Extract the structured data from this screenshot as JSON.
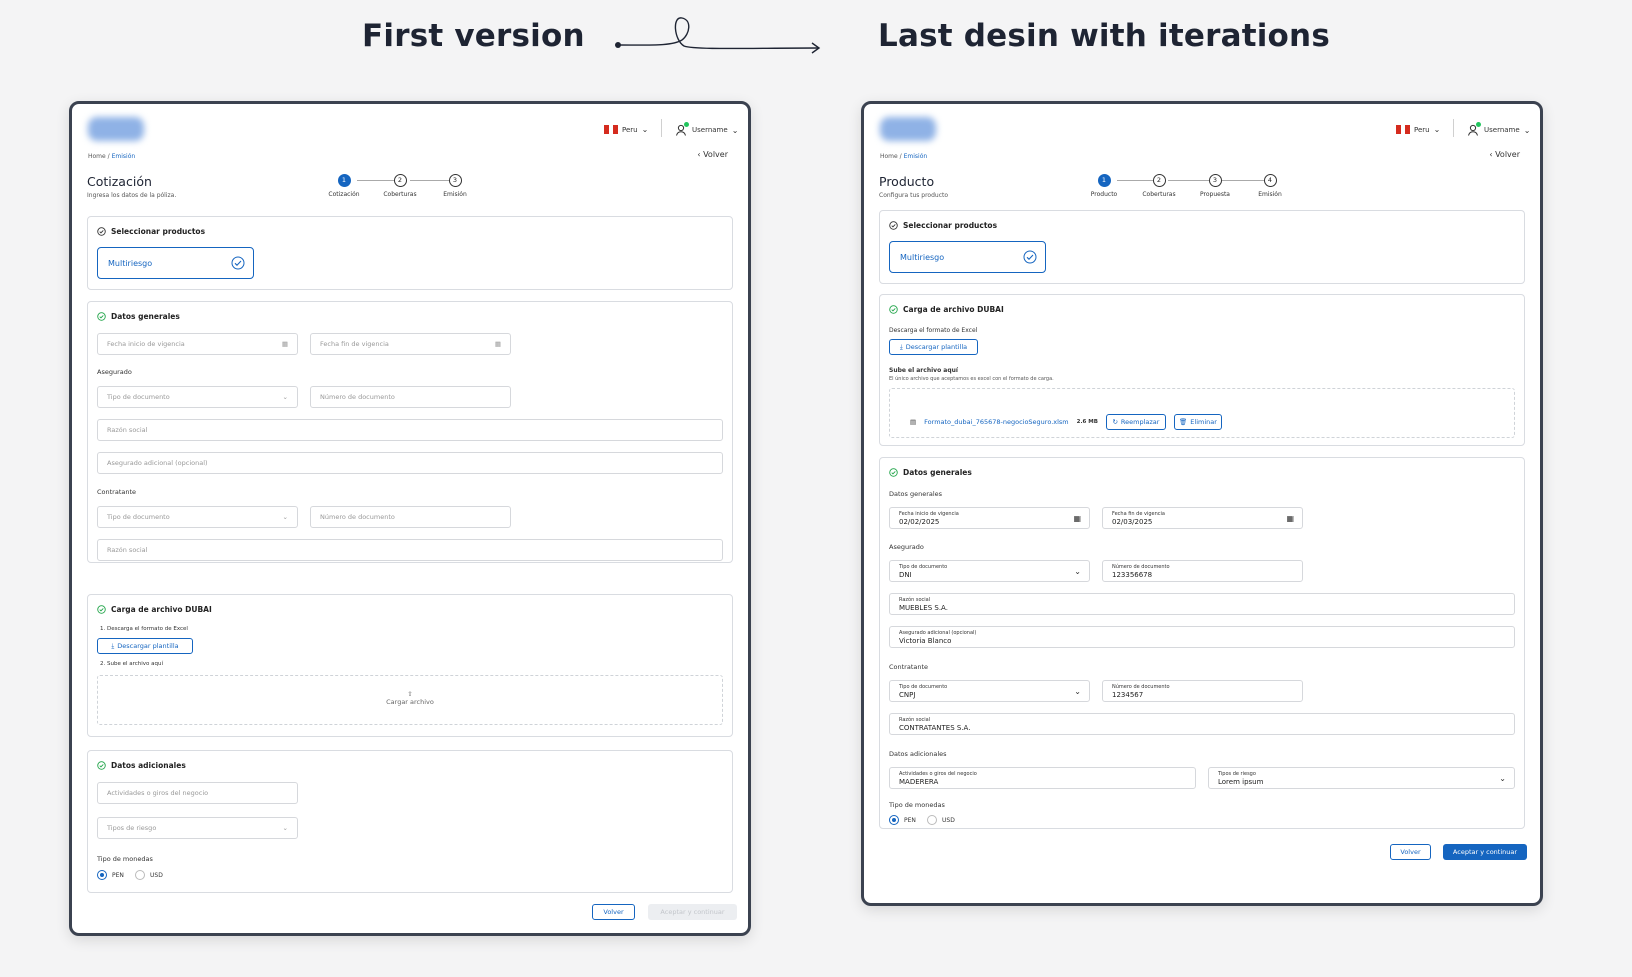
{
  "headings": {
    "left": "First version",
    "right": "Last desin with iterations"
  },
  "v1": {
    "country": "Peru",
    "username": "Username",
    "breadcrumb": {
      "home": "Home",
      "sep": "/",
      "current": "Emisión"
    },
    "back": "Volver",
    "title": "Cotización",
    "subtitle": "Ingresa los datos de la póliza.",
    "steps": [
      {
        "n": "1",
        "label": "Cotización"
      },
      {
        "n": "2",
        "label": "Coberturas"
      },
      {
        "n": "3",
        "label": "Emisión"
      }
    ],
    "select_products": {
      "title": "Seleccionar productos",
      "product": "Multiriesgo"
    },
    "datos_generales": {
      "title": "Datos generales",
      "fecha_inicio": "Fecha inicio de vigencia",
      "fecha_fin": "Fecha fin de vigencia",
      "asegurado": "Asegurado",
      "tipo_doc": "Tipo de documento",
      "num_doc": "Número de documento",
      "razon_social": "Razón social",
      "asegurado_adicional": "Asegurado adicional (opcional)",
      "contratante": "Contratante",
      "tipo_doc2": "Tipo de documento",
      "num_doc2": "Número de documento",
      "razon_social2": "Razón social"
    },
    "carga": {
      "title": "Carga de archivo DUBAI",
      "step1": "1. Descarga el formato de Excel",
      "download": "Descargar plantilla",
      "step2": "2. Sube el archivo aquí",
      "upload": "Cargar archivo"
    },
    "adicionales": {
      "title": "Datos adicionales",
      "actividades": "Actividades o giros del negocio",
      "tipos_riesgo": "Tipos de riesgo",
      "moneda_label": "Tipo de monedas",
      "pen": "PEN",
      "usd": "USD"
    },
    "footer": {
      "back": "Volver",
      "accept": "Aceptar y continuar"
    }
  },
  "v2": {
    "country": "Peru",
    "username": "Username",
    "breadcrumb": {
      "home": "Home",
      "sep": "/",
      "current": "Emisión"
    },
    "back": "Volver",
    "title": "Producto",
    "subtitle": "Configura tus producto",
    "steps": [
      {
        "n": "1",
        "label": "Producto"
      },
      {
        "n": "2",
        "label": "Coberturas"
      },
      {
        "n": "3",
        "label": "Propuesta"
      },
      {
        "n": "4",
        "label": "Emisión"
      }
    ],
    "select_products": {
      "title": "Seleccionar productos",
      "product": "Multiriesgo"
    },
    "carga": {
      "title": "Carga de archivo DUBAI",
      "download_label": "Descarga el formato de Excel",
      "download": "Descargar plantilla",
      "upload_label": "Sube el archivo aquí",
      "upload_hint": "El único archivo que aceptamos es excel con el formato de carga.",
      "file_name": "Formato_dubai_765678-negocioSeguro.xlsm",
      "file_size": "2.6 MB",
      "replace": "Reemplazar",
      "delete": "Eliminar"
    },
    "datos_generales": {
      "title": "Datos generales",
      "section_label": "Datos generales",
      "fecha_inicio": {
        "label": "Fecha inicio de vigencia",
        "value": "02/02/2025"
      },
      "fecha_fin": {
        "label": "Fecha fin de vigencia",
        "value": "02/03/2025"
      },
      "asegurado": "Asegurado",
      "tipo_doc": {
        "label": "Tipo de documento",
        "value": "DNI"
      },
      "num_doc": {
        "label": "Número de documento",
        "value": "123356678"
      },
      "razon_social": {
        "label": "Razón social",
        "value": "MUEBLES S.A."
      },
      "asegurado_adicional": {
        "label": "Asegurado adicional (opcional)",
        "value": "Victoria Blanco"
      },
      "contratante": "Contratante",
      "tipo_doc2": {
        "label": "Tipo de documento",
        "value": "CNPJ"
      },
      "num_doc2": {
        "label": "Número de documento",
        "value": "1234567"
      },
      "razon_social2": {
        "label": "Razón social",
        "value": "CONTRATANTES S.A."
      },
      "adicionales_label": "Datos adicionales",
      "actividades": {
        "label": "Actividades o giros del negocio",
        "value": "MADERERA"
      },
      "tipos_riesgo": {
        "label": "Tipos de riesgo",
        "value": "Lorem ipsum"
      },
      "moneda_label": "Tipo de monedas",
      "pen": "PEN",
      "usd": "USD"
    },
    "footer": {
      "back": "Volver",
      "accept": "Aceptar y continuar"
    }
  }
}
